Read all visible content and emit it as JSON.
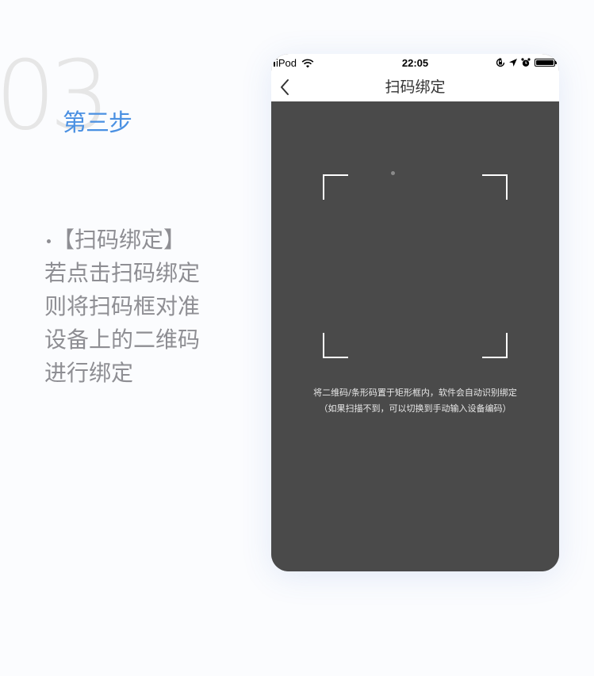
{
  "step": {
    "number": "03",
    "title": "第三步"
  },
  "description": {
    "heading": "【扫码绑定】",
    "lines": [
      "若点击扫码绑定",
      "则将扫码框对准",
      "设备上的二维码",
      "进行绑定"
    ]
  },
  "phone": {
    "status_bar": {
      "carrier": "iPod",
      "time": "22:05",
      "icons": [
        "wifi-icon",
        "orientation-lock-icon",
        "location-arrow-icon",
        "alarm-icon",
        "battery-icon"
      ]
    },
    "nav": {
      "back_icon": "chevron-left-icon",
      "title": "扫码绑定"
    },
    "scanner": {
      "hint_line1": "将二维码/条形码置于矩形框内，软件会自动识别绑定",
      "hint_line2": "（如果扫描不到，可以切换到手动输入设备编码）",
      "background_color": "#4a4a4a",
      "frame_color": "#ffffff"
    }
  },
  "colors": {
    "accent": "#4a90e2",
    "step_number": "#e6e6e6",
    "description_text": "#8e8e93"
  }
}
